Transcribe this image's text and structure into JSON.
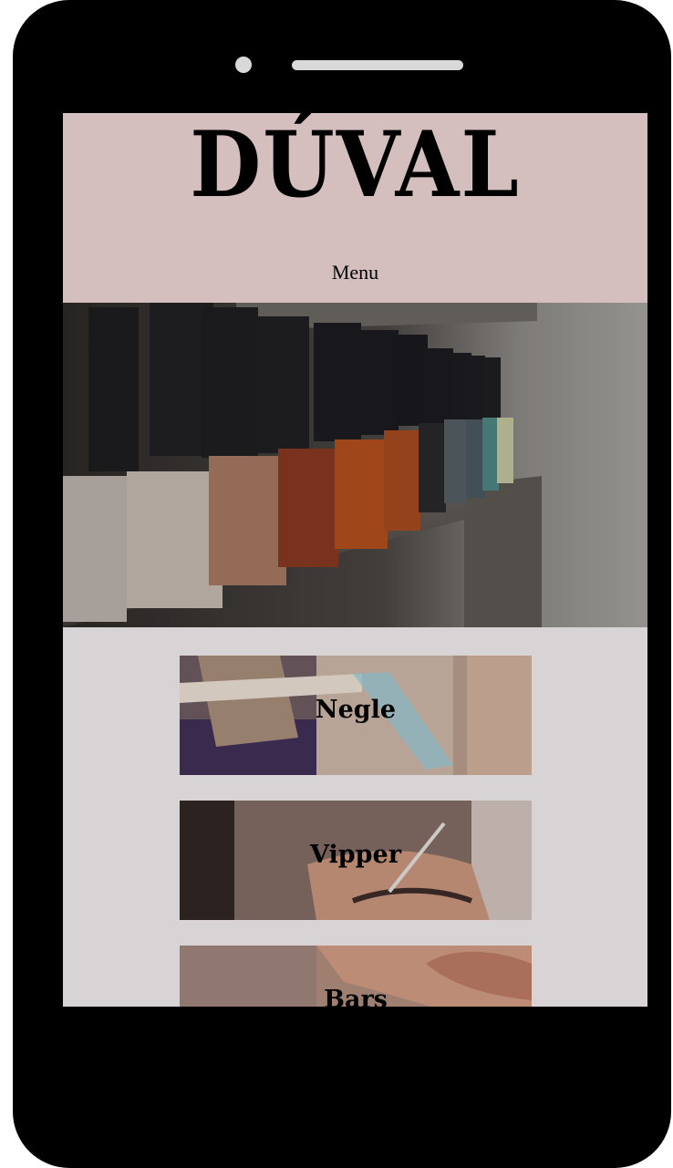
{
  "brand": {
    "logo": "DÚVAL"
  },
  "nav": {
    "menu_label": "Menu"
  },
  "hero": {
    "image": "nail-polish-bottles-on-shelf"
  },
  "services": [
    {
      "label": "Negle",
      "image": "nail-salon-photo"
    },
    {
      "label": "Vipper",
      "image": "lash-treatment-photo"
    },
    {
      "label": "Bars",
      "image": "brow-treatment-photo"
    }
  ],
  "colors": {
    "header_bg": "#d4bfbe",
    "body_bg": "#d8d4d5",
    "device_frame": "#000000"
  }
}
